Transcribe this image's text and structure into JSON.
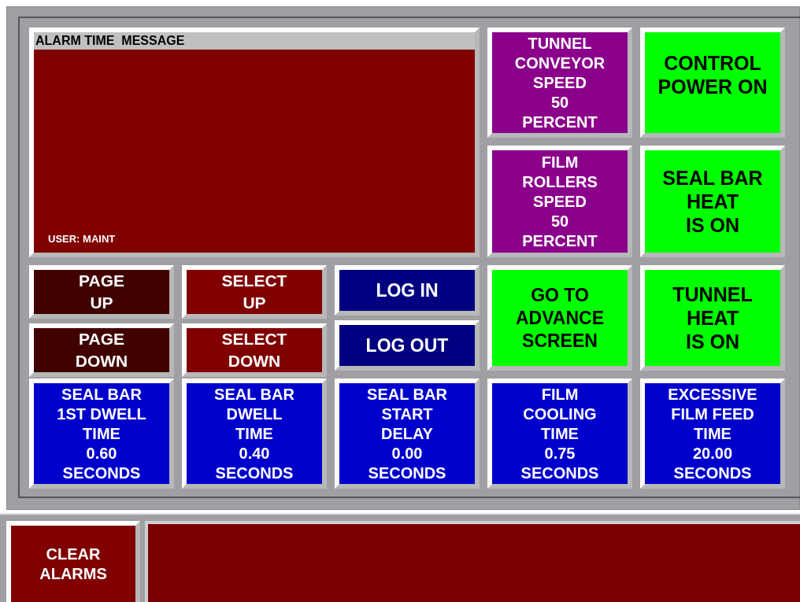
{
  "alarm_panel": {
    "header": "ALARM TIME  MESSAGE",
    "user": "USER: MAINT"
  },
  "speed_tiles": [
    {
      "lines": [
        "TUNNEL",
        "CONVEYOR",
        "SPEED",
        "50",
        "PERCENT"
      ],
      "color": "#8b008b"
    },
    {
      "lines": [
        "FILM",
        "ROLLERS",
        "SPEED",
        "50",
        "PERCENT"
      ],
      "color": "#8b008b"
    }
  ],
  "status_tiles": [
    {
      "lines": [
        "CONTROL",
        "POWER ON"
      ],
      "color": "#00ff00"
    },
    {
      "lines": [
        "SEAL BAR",
        "HEAT",
        "IS ON"
      ],
      "color": "#00ff00"
    },
    {
      "lines": [
        "TUNNEL",
        "HEAT",
        "IS ON"
      ],
      "color": "#00ff00"
    }
  ],
  "nav_columns": [
    [
      {
        "lines": [
          "PAGE",
          "UP"
        ],
        "color": "#400000"
      },
      {
        "lines": [
          "PAGE",
          "DOWN"
        ],
        "color": "#400000"
      }
    ],
    [
      {
        "lines": [
          "SELECT",
          "UP"
        ],
        "color": "#800000"
      },
      {
        "lines": [
          "SELECT",
          "DOWN"
        ],
        "color": "#800000"
      }
    ],
    [
      {
        "lines": [
          "LOG IN"
        ],
        "color": "#000080"
      },
      {
        "lines": [
          "LOG OUT"
        ],
        "color": "#000080"
      }
    ]
  ],
  "advance_button": {
    "lines": [
      "GO TO",
      "ADVANCE",
      "SCREEN"
    ],
    "color": "#00ff00"
  },
  "timer_tiles": [
    {
      "lines": [
        "SEAL BAR",
        "1ST DWELL",
        "TIME",
        "0.60",
        "SECONDS"
      ],
      "color": "#0000cc"
    },
    {
      "lines": [
        "SEAL BAR",
        "DWELL",
        "TIME",
        "0.40",
        "SECONDS"
      ],
      "color": "#0000cc"
    },
    {
      "lines": [
        "SEAL BAR",
        "START",
        "DELAY",
        "0.00",
        "SECONDS"
      ],
      "color": "#0000cc"
    },
    {
      "lines": [
        "FILM",
        "COOLING",
        "TIME",
        "0.75",
        "SECONDS"
      ],
      "color": "#0000cc"
    },
    {
      "lines": [
        "EXCESSIVE",
        "FILM FEED",
        "TIME",
        "20.00",
        "SECONDS"
      ],
      "color": "#0000cc"
    }
  ],
  "clear_button": {
    "lines": [
      "CLEAR",
      "ALARMS"
    ],
    "color": "#800000"
  }
}
